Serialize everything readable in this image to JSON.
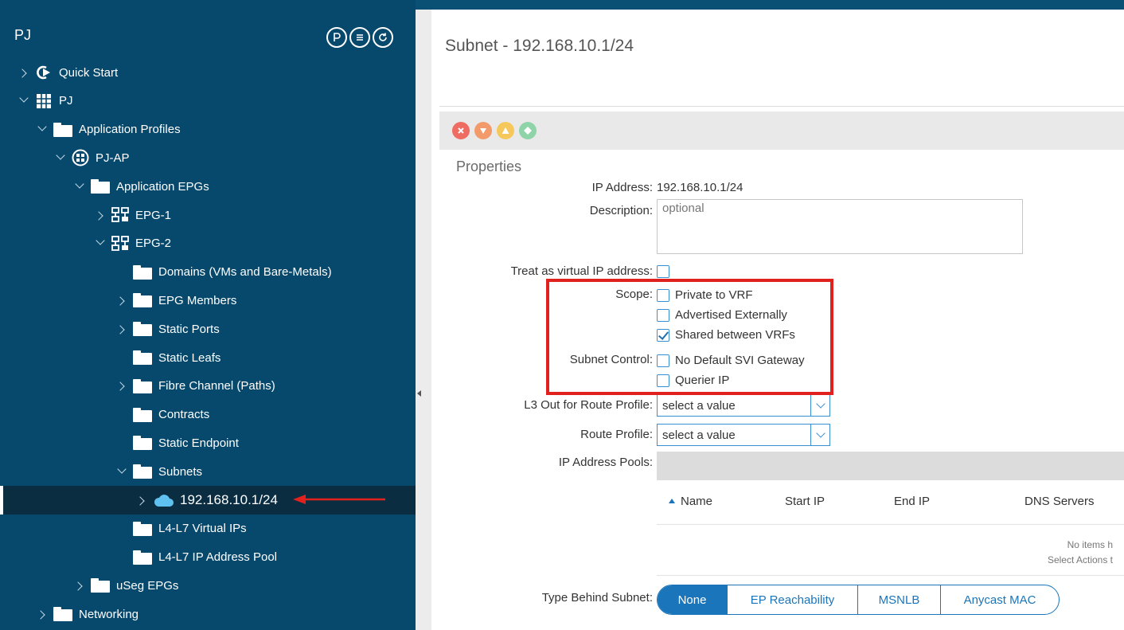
{
  "sidebar": {
    "title": "PJ",
    "tree": [
      {
        "label": "Quick Start",
        "chevron": "right",
        "icon": "quick-start-icon"
      },
      {
        "label": "PJ",
        "chevron": "down",
        "icon": "tenant-icon"
      },
      {
        "label": "Application Profiles",
        "chevron": "down",
        "icon": "folder-icon"
      },
      {
        "label": "PJ-AP",
        "chevron": "down",
        "icon": "app-profile-icon"
      },
      {
        "label": "Application EPGs",
        "chevron": "down",
        "icon": "folder-icon"
      },
      {
        "label": "EPG-1",
        "chevron": "right",
        "icon": "epg-icon"
      },
      {
        "label": "EPG-2",
        "chevron": "down",
        "icon": "epg-icon"
      },
      {
        "label": "Domains (VMs and Bare-Metals)",
        "chevron": "none",
        "icon": "folder-icon"
      },
      {
        "label": "EPG Members",
        "chevron": "right",
        "icon": "folder-icon"
      },
      {
        "label": "Static Ports",
        "chevron": "right",
        "icon": "folder-icon"
      },
      {
        "label": "Static Leafs",
        "chevron": "none",
        "icon": "folder-icon"
      },
      {
        "label": "Fibre Channel (Paths)",
        "chevron": "right",
        "icon": "folder-icon"
      },
      {
        "label": "Contracts",
        "chevron": "none",
        "icon": "folder-icon"
      },
      {
        "label": "Static Endpoint",
        "chevron": "none",
        "icon": "folder-icon"
      },
      {
        "label": "Subnets",
        "chevron": "down",
        "icon": "folder-icon"
      },
      {
        "label": "192.168.10.1/24",
        "chevron": "right",
        "icon": "cloud-icon",
        "selected": true
      },
      {
        "label": "L4-L7 Virtual IPs",
        "chevron": "none",
        "icon": "folder-icon"
      },
      {
        "label": "L4-L7 IP Address Pool",
        "chevron": "none",
        "icon": "folder-icon"
      },
      {
        "label": "uSeg EPGs",
        "chevron": "right",
        "icon": "folder-icon"
      },
      {
        "label": "Networking",
        "chevron": "right",
        "icon": "folder-icon"
      }
    ]
  },
  "main": {
    "title": "Subnet - 192.168.10.1/24",
    "section_title": "Properties",
    "ip_address_label": "IP Address:",
    "ip_address_value": "192.168.10.1/24",
    "description_label": "Description:",
    "description_placeholder": "optional",
    "virtual_ip_label": "Treat as virtual IP address:",
    "scope_label": "Scope:",
    "scope_options": [
      {
        "label": "Private to VRF",
        "checked": false
      },
      {
        "label": "Advertised Externally",
        "checked": false
      },
      {
        "label": "Shared between VRFs",
        "checked": true
      }
    ],
    "subnet_control_label": "Subnet Control:",
    "subnet_control_options": [
      {
        "label": "No Default SVI Gateway",
        "checked": false
      },
      {
        "label": "Querier IP",
        "checked": false
      }
    ],
    "l3out_label": "L3 Out for Route Profile:",
    "l3out_value": "select a value",
    "route_profile_label": "Route Profile:",
    "route_profile_value": "select a value",
    "pools_label": "IP Address Pools:",
    "pool_columns": [
      "Name",
      "Start IP",
      "End IP",
      "DNS Servers"
    ],
    "pool_empty_line1": "No items h",
    "pool_empty_line2": "Select Actions t",
    "type_behind_label": "Type Behind Subnet:",
    "type_behind_options": [
      "None",
      "EP Reachability",
      "MSNLB",
      "Anycast MAC"
    ],
    "type_behind_selected": "None"
  },
  "colors": {
    "sidebar_bg": "#07496d",
    "selected_row": "#0a2d42",
    "accent": "#1b75bb",
    "highlight": "#e0211d"
  }
}
